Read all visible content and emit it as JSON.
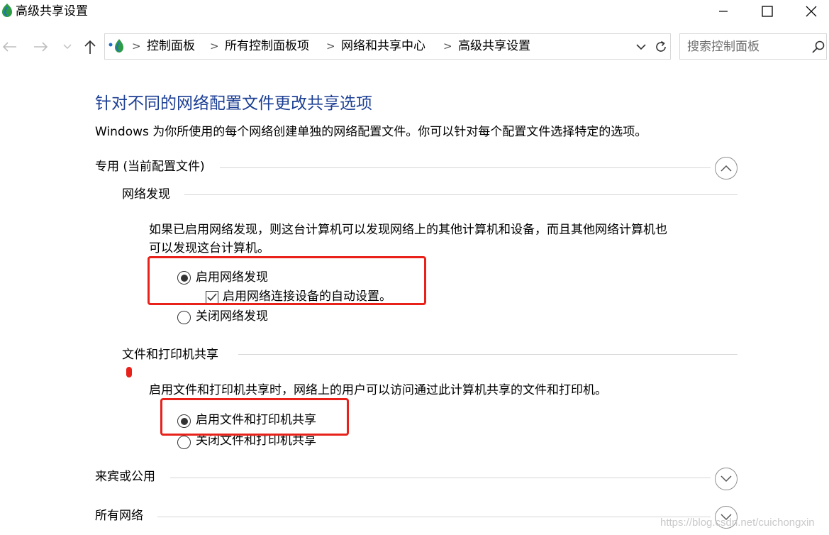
{
  "window": {
    "title": "高级共享设置"
  },
  "nav": {
    "breadcrumbs": [
      "控制面板",
      "所有控制面板项",
      "网络和共享中心",
      "高级共享设置"
    ],
    "separator": ">",
    "search_placeholder": "搜索控制面板"
  },
  "main": {
    "title": "针对不同的网络配置文件更改共享选项",
    "description": "Windows 为你所使用的每个网络创建单独的网络配置文件。你可以针对每个配置文件选择特定的选项。",
    "profiles": [
      {
        "name": "专用 (当前配置文件)",
        "expanded": true,
        "network_discovery": {
          "heading": "网络发现",
          "desc_line1": "如果已启用网络发现，则这台计算机可以发现网络上的其他计算机和设备，而且其他网络计算机也",
          "desc_line2": "可以发现这台计算机。",
          "opt_on": "启用网络发现",
          "opt_auto": "启用网络连接设备的自动设置。",
          "opt_off": "关闭网络发现",
          "selected": "on",
          "auto_checked": true
        },
        "file_printer_sharing": {
          "heading": "文件和打印机共享",
          "desc": "启用文件和打印机共享时，网络上的用户可以访问通过此计算机共享的文件和打印机。",
          "opt_on": "启用文件和打印机共享",
          "opt_off": "关闭文件和打印机共享",
          "selected": "on"
        }
      },
      {
        "name": "来宾或公用",
        "expanded": false
      },
      {
        "name": "所有网络",
        "expanded": false
      }
    ]
  },
  "watermark": "https://blog.csdn.net/cuichongxin",
  "colors": {
    "title_blue": "#1c3f94",
    "highlight_red": "#e8221b",
    "app_icon_green": "#2e9b46",
    "app_icon_blue": "#1f6fc4"
  },
  "icons": [
    "control-panel-icon",
    "back-arrow-icon",
    "forward-arrow-icon",
    "recent-dropdown-icon",
    "up-arrow-icon",
    "chevron-down-icon",
    "refresh-icon",
    "search-icon",
    "minimize-icon",
    "maximize-icon",
    "close-icon",
    "chevron-up-circle-icon",
    "chevron-down-circle-icon",
    "radio-selected-icon",
    "radio-unselected-icon",
    "checkbox-checked-icon"
  ]
}
